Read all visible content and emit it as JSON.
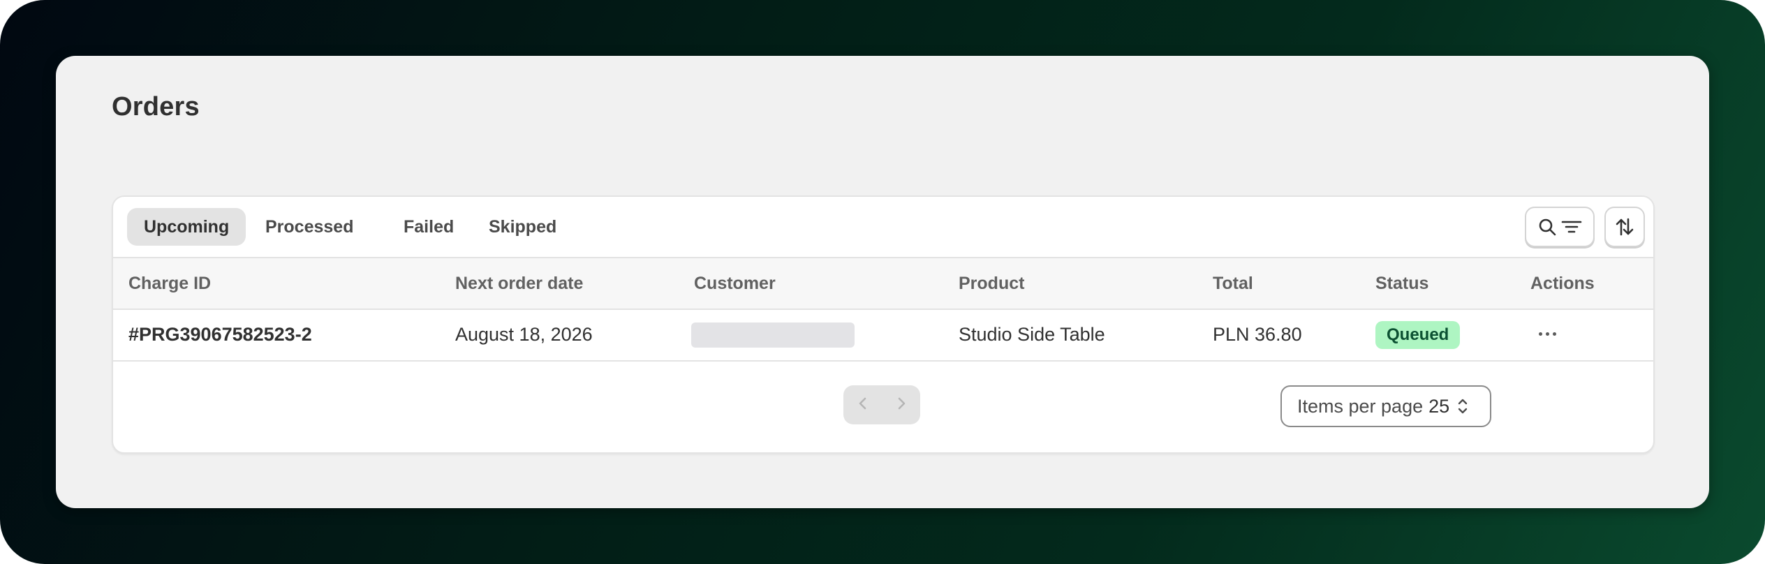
{
  "page": {
    "title": "Orders"
  },
  "tabs": [
    {
      "label": "Upcoming",
      "active": true
    },
    {
      "label": "Processed",
      "active": false
    },
    {
      "label": "Failed",
      "active": false
    },
    {
      "label": "Skipped",
      "active": false
    }
  ],
  "toolbar": {
    "search_filter_icon": "search-filter-icon",
    "sort_icon": "sort-icon"
  },
  "table": {
    "columns": [
      "Charge ID",
      "Next order date",
      "Customer",
      "Product",
      "Total",
      "Status",
      "Actions"
    ],
    "rows": [
      {
        "charge_id": "#PRG39067582523-2",
        "next_order_date": "August 18, 2026",
        "customer": "",
        "product": "Studio Side Table",
        "total": "PLN 36.80",
        "status": "Queued",
        "actions_icon": "more-horizontal-icon"
      }
    ]
  },
  "pagination": {
    "prev_icon": "chevron-left-icon",
    "next_icon": "chevron-right-icon",
    "items_per_page_label": "Items per page",
    "items_per_page_value": "25"
  },
  "colors": {
    "status_queued_bg": "#aef5c2",
    "status_queued_text": "#0c5132",
    "active_tab_bg": "#e3e3e3"
  }
}
